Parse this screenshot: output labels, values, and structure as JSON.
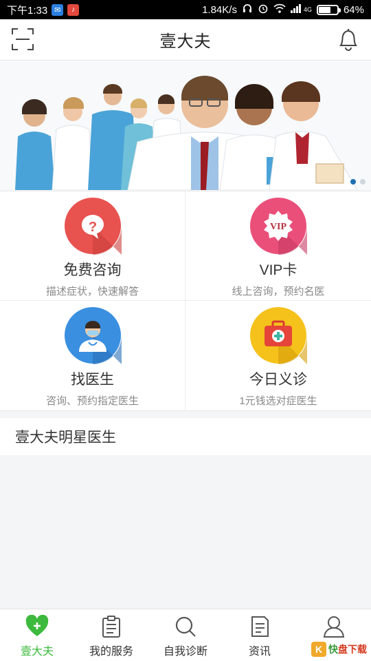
{
  "status_bar": {
    "time": "下午1:33",
    "net_speed": "1.84K/s",
    "network": "4G",
    "battery": "64%",
    "battery_level": 0.64
  },
  "header": {
    "title": "壹大夫",
    "left_icon": "scan-icon",
    "right_icon": "bell-icon"
  },
  "banner": {
    "slide_count": 2,
    "active_slide": 1
  },
  "features": [
    {
      "name": "免费咨询",
      "desc": "描述症状，快速解答",
      "icon": "question-bubble-icon",
      "color": "#e8524f"
    },
    {
      "name": "VIP卡",
      "desc": "线上咨询，预约名医",
      "icon": "vip-badge-icon",
      "color": "#ea4f7a"
    },
    {
      "name": "找医生",
      "desc": "咨询、预约指定医生",
      "icon": "doctor-icon",
      "color": "#3a8fe0"
    },
    {
      "name": "今日义诊",
      "desc": "1元钱选对症医生",
      "icon": "medical-kit-icon",
      "color": "#f5c11b"
    }
  ],
  "section": {
    "title": "壹大夫明星医生"
  },
  "tabs": [
    {
      "label": "壹大夫",
      "icon": "heart-plus-icon",
      "active": true
    },
    {
      "label": "我的服务",
      "icon": "clipboard-icon",
      "active": false
    },
    {
      "label": "自我诊断",
      "icon": "search-icon",
      "active": false
    },
    {
      "label": "资讯",
      "icon": "document-icon",
      "active": false
    },
    {
      "label": "",
      "icon": "user-icon",
      "active": false
    }
  ],
  "colors": {
    "accent_green": "#3dba3d",
    "banner_dot_active": "#1f6fb3"
  }
}
